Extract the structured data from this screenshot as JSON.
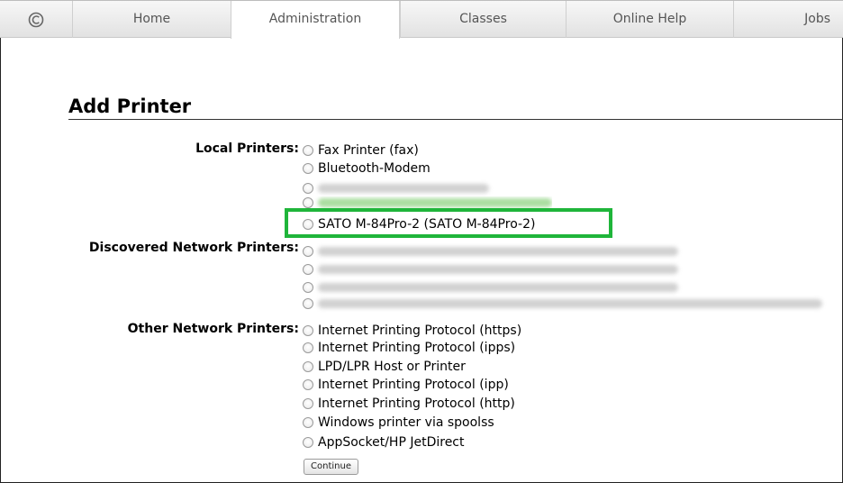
{
  "nav": {
    "tabs": [
      {
        "label": "Home"
      },
      {
        "label": "Administration"
      },
      {
        "label": "Classes"
      },
      {
        "label": "Online Help"
      },
      {
        "label": "Jobs"
      }
    ],
    "active_tab": "Administration"
  },
  "page": {
    "title": "Add Printer"
  },
  "local_printers": {
    "label": "Local Printers:",
    "options": [
      {
        "label": "Fax Printer (fax)"
      },
      {
        "label": "Bluetooth-Modem"
      },
      {
        "label": "SATO M-84Pro-2 (SATO M-84Pro-2)"
      }
    ]
  },
  "discovered_network_printers": {
    "label": "Discovered Network Printers:"
  },
  "other_network_printers": {
    "label": "Other Network Printers:",
    "options": [
      {
        "label": "Internet Printing Protocol (https)"
      },
      {
        "label": "Internet Printing Protocol (ipps)"
      },
      {
        "label": "LPD/LPR Host or Printer"
      },
      {
        "label": "Internet Printing Protocol (ipp)"
      },
      {
        "label": "Internet Printing Protocol (http)"
      },
      {
        "label": "Windows printer via spoolss"
      },
      {
        "label": "AppSocket/HP JetDirect"
      }
    ]
  },
  "actions": {
    "continue_label": "Continue"
  },
  "colors": {
    "highlight": "#1fb53a"
  }
}
